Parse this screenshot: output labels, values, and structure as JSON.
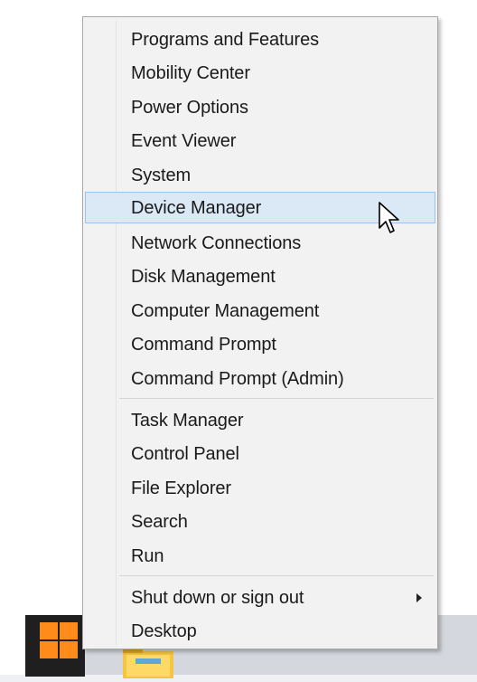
{
  "menu": {
    "group1": [
      {
        "label": "Programs and Features"
      },
      {
        "label": "Mobility Center"
      },
      {
        "label": "Power Options"
      },
      {
        "label": "Event Viewer"
      },
      {
        "label": "System"
      },
      {
        "label": "Device Manager",
        "highlighted": true
      },
      {
        "label": "Network Connections"
      },
      {
        "label": "Disk Management"
      },
      {
        "label": "Computer Management"
      },
      {
        "label": "Command Prompt"
      },
      {
        "label": "Command Prompt (Admin)"
      }
    ],
    "group2": [
      {
        "label": "Task Manager"
      },
      {
        "label": "Control Panel"
      },
      {
        "label": "File Explorer"
      },
      {
        "label": "Search"
      },
      {
        "label": "Run"
      }
    ],
    "group3": [
      {
        "label": "Shut down or sign out",
        "has_submenu": true,
        "submenu_icon": "chevron-right-icon"
      },
      {
        "label": "Desktop"
      }
    ],
    "highlight_color": "#dbe8f6",
    "highlight_border": "#9fc3e8"
  },
  "taskbar": {
    "start_icon": "windows-logo-icon",
    "start_logo_color": "#ff8c1a",
    "app_icon": "file-explorer-icon"
  }
}
